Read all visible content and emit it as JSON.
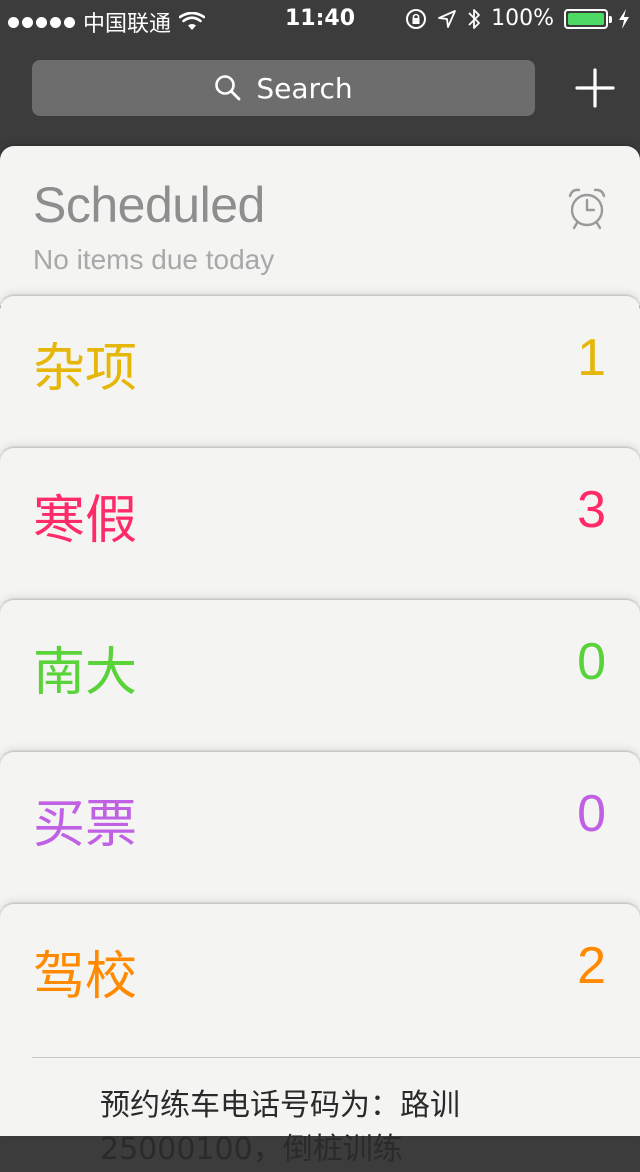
{
  "status_bar": {
    "carrier": "中国联通",
    "time": "11:40",
    "battery": "100%",
    "battery_level": 1.0,
    "icons": [
      "signal-dots-icon",
      "wifi-icon",
      "orientation-lock-icon",
      "location-arrow-icon",
      "bluetooth-icon",
      "battery-icon",
      "charging-bolt-icon"
    ]
  },
  "search": {
    "placeholder": "Search",
    "icon": "search-icon"
  },
  "add_button": {
    "icon": "plus-icon"
  },
  "scheduled": {
    "title": "Scheduled",
    "subtitle": "No items due today",
    "icon": "alarm-clock-icon"
  },
  "lists": [
    {
      "name": "杂项",
      "count": "1",
      "color": "#e6b70a"
    },
    {
      "name": "寒假",
      "count": "3",
      "color": "#ff2a68"
    },
    {
      "name": "南大",
      "count": "0",
      "color": "#5ad33b"
    },
    {
      "name": "买票",
      "count": "0",
      "color": "#c061e3"
    },
    {
      "name": "驾校",
      "count": "2",
      "color": "#ff8a00"
    }
  ],
  "reminder_preview": {
    "line1": "预约练车电话号码为：路训",
    "line2": "25000100，倒桩训练"
  },
  "colors": {
    "top_background": "#3c3c3c",
    "card_background": "#f4f4f3",
    "battery_green": "#4cd964"
  }
}
